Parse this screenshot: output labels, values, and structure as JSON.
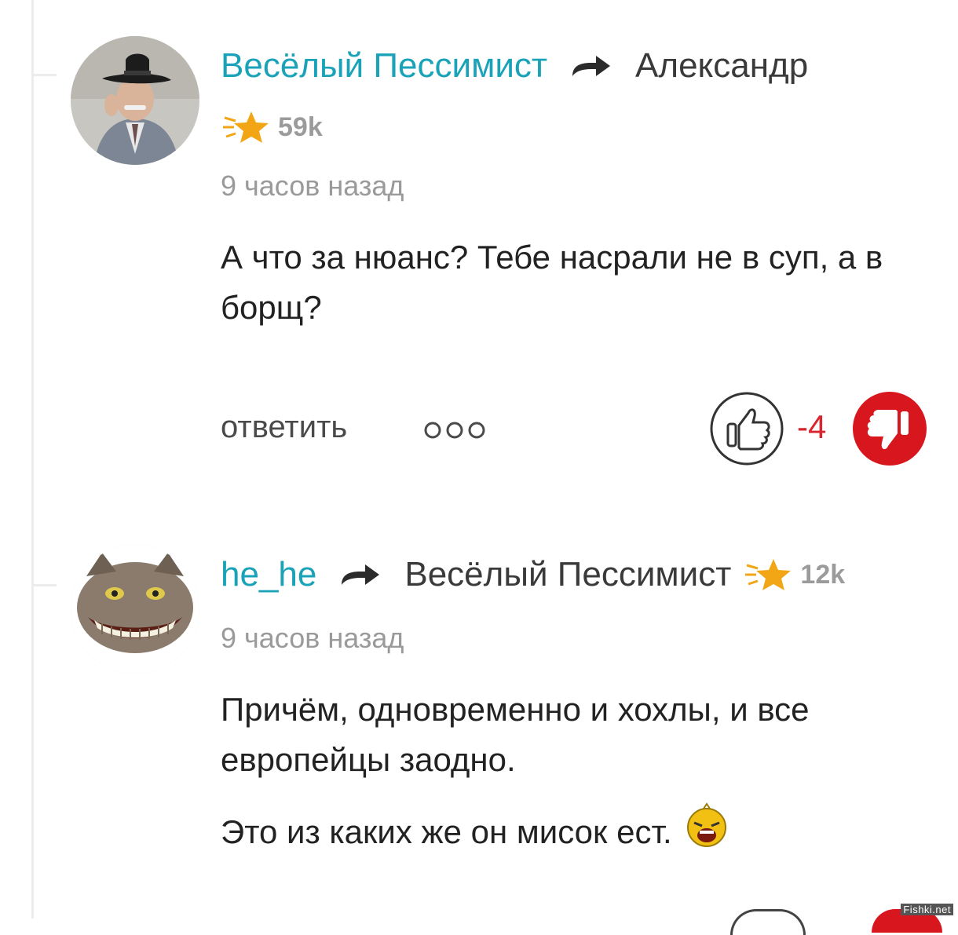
{
  "comments": [
    {
      "author": "Весёлый Пессимист",
      "reply_to": "Александр",
      "rating": "59k",
      "time": "9 часов назад",
      "text_paragraphs": [
        "А что за нюанс? Тебе насрали не в суп, а в борщ?"
      ],
      "actions": {
        "reply": "ответить",
        "score": "-4"
      },
      "icons": {
        "avatar": "avatar-man-in-hat",
        "arrow": "reply-arrow-icon",
        "star": "rating-star-icon",
        "more": "more-dots-icon",
        "like": "thumb-up-icon",
        "dislike": "thumb-down-icon"
      }
    },
    {
      "author": "he_he",
      "reply_to": "Весёлый Пессимист",
      "rating": "12k",
      "time": "9 часов назад",
      "text_paragraphs": [
        "Причём, одновременно и хохлы, и все европейцы заодно.",
        "Это из каких же он мисок ест."
      ],
      "icons": {
        "avatar": "avatar-grinning-cat",
        "arrow": "reply-arrow-icon",
        "star": "rating-star-icon",
        "emoji": "laughing-emoji-icon"
      }
    }
  ],
  "watermark": "Fishki.net",
  "colors": {
    "author": "#1aa3b8",
    "score_negative": "#d8252e",
    "dislike_active": "#d8161e",
    "star": "#f2a615"
  }
}
